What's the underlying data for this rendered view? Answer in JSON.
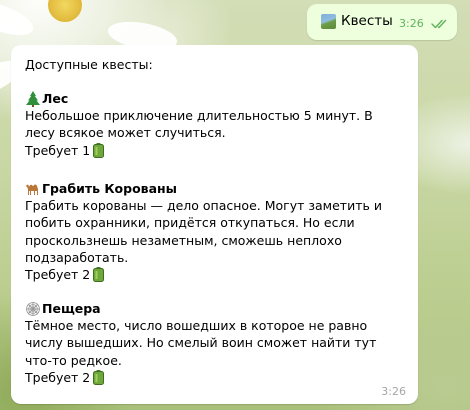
{
  "outgoing": {
    "emoji": "forest-landscape-icon",
    "text": "Квесты",
    "time": "3:26",
    "status": "read-double-check-icon"
  },
  "incoming": {
    "intro": "Доступные квесты:",
    "time": "3:26",
    "quests": [
      {
        "icon": "evergreen-tree-icon",
        "title": "Лес",
        "description": "Небольшое приключение длительностью 5 минут. В лесу всякое может случиться.",
        "requirement": "Требует 1",
        "requirement_icon": "battery-icon"
      },
      {
        "icon": "camel-icon",
        "title": "Грабить Корованы",
        "description": "Грабить корованы — дело опасное. Могут заметить и побить охранники, придётся откупаться. Но если проскользнешь незаметным, сможешь неплохо подзаработать.",
        "requirement": "Требует 2",
        "requirement_icon": "battery-icon"
      },
      {
        "icon": "spider-web-icon",
        "title": "Пещера",
        "description": "Тёмное место, число вошедших в которое не равно числу вышедших. Но смелый воин сможет найти тут что-то редкое.",
        "requirement": "Требует 2",
        "requirement_icon": "battery-icon"
      }
    ]
  },
  "colors": {
    "outgoing_bubble": "#eeffde",
    "incoming_bubble": "#ffffff",
    "outgoing_meta": "#5fb25a",
    "incoming_meta": "#a6a6a6"
  }
}
